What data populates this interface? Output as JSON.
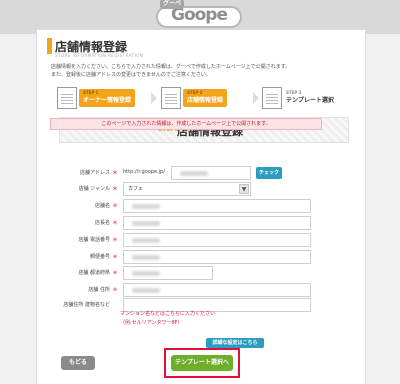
{
  "logo": {
    "chip": "グーペ",
    "text": "Goope"
  },
  "header": {
    "title": "店舗情報登録",
    "subtitle": "STORE INFORMATION REGISTRATION",
    "intro_lines": [
      "店舗情報を入力ください。こちらで入力された情報は、グーペで作成したホームページ上で公開されます。",
      "また、登録後に店舗アドレスの変更はできませんのでご注意ください。"
    ]
  },
  "steps": [
    {
      "num": "STEP 1",
      "label": "オーナー情報登録"
    },
    {
      "num": "STEP 2",
      "label": "店舗情報登録"
    },
    {
      "num": "STEP 3",
      "label": "テンプレート選択"
    }
  ],
  "section": {
    "step_tag": "STEP2",
    "title": "店舗情報登録"
  },
  "notice": "このページで入力された情報は、作成したホームページ上で公開されます。",
  "form": {
    "address": {
      "label": "店舗アドレス",
      "required": "＊",
      "prefix": "http://r.goope.jp/",
      "check": "チェック"
    },
    "genre": {
      "label": "店舗 ジャンル",
      "required": "＊",
      "value": "カフェ",
      "caret": "▼"
    },
    "name": {
      "label": "店舗名",
      "required": "＊"
    },
    "owner": {
      "label": "店長名",
      "required": "＊"
    },
    "phone": {
      "label": "店舗 電話番号",
      "required": "＊"
    },
    "postal": {
      "label": "郵便番号",
      "required": "＊"
    },
    "pref": {
      "label": "店舗 都道府県",
      "required": "＊"
    },
    "addr": {
      "label": "店舗 住所",
      "required": "＊"
    },
    "building": {
      "label": "店舗住所 建物名など",
      "required": ""
    }
  },
  "notes": [
    "マンション名などはこちらに入力ください",
    "（例:セルリアンタワー8F）"
  ],
  "buttons": {
    "advanced": "詳細な設定はこちら",
    "back": "もどる",
    "next": "テンプレート選択へ"
  }
}
